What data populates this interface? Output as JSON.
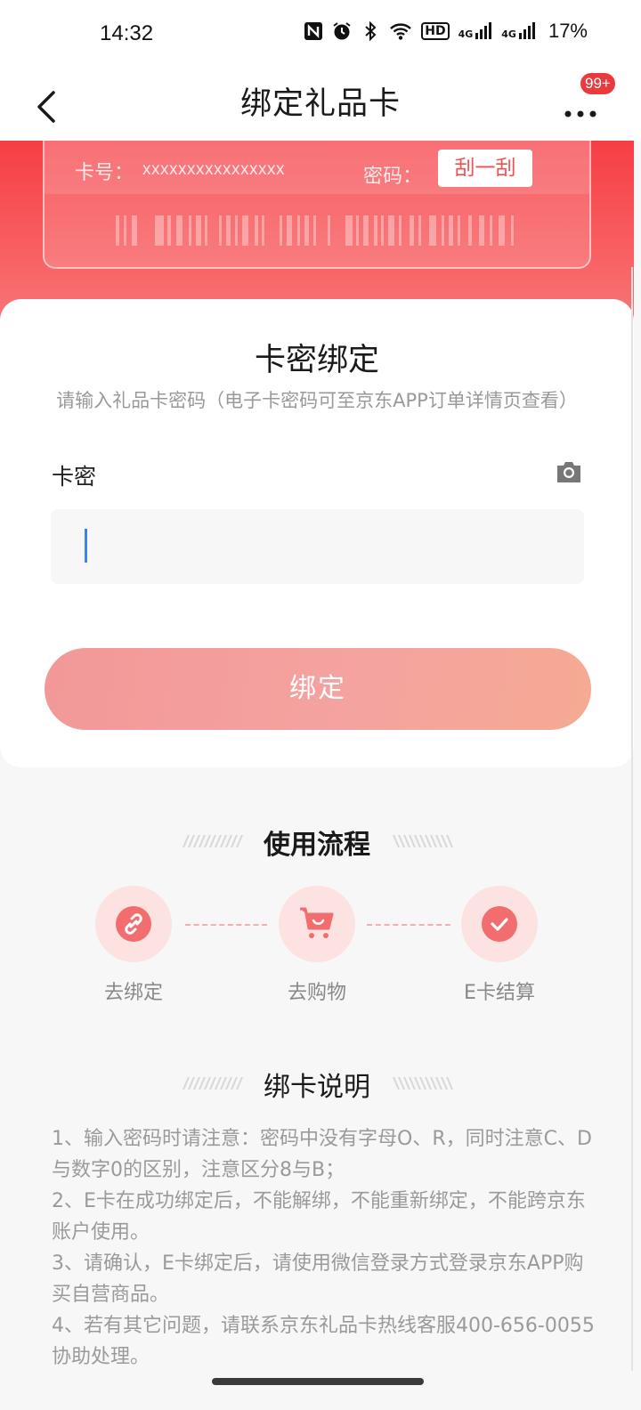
{
  "status_bar": {
    "time": "14:32",
    "icons": [
      "nfc-icon",
      "alarm-icon",
      "bluetooth-icon",
      "wifi-icon",
      "hd-icon",
      "signal-4g-icon",
      "signal-4g-icon"
    ],
    "hd_label": "HD",
    "net_label": "4G",
    "battery": "17%"
  },
  "nav": {
    "title": "绑定礼品卡",
    "badge": "99+"
  },
  "card_preview": {
    "number_label": "卡号：",
    "number_value": "xxxxxxxxxxxxxxxx",
    "password_label": "密码：",
    "scratch_label": "刮一刮"
  },
  "bind_card": {
    "title": "卡密绑定",
    "subtitle": "请输入礼品卡密码（电子卡密码可至京东APP订单详情页查看）",
    "field_label": "卡密",
    "input_value": "",
    "button_label": "绑定"
  },
  "process": {
    "title": "使用流程",
    "steps": [
      {
        "label": "去绑定",
        "icon": "link-icon"
      },
      {
        "label": "去购物",
        "icon": "cart-icon"
      },
      {
        "label": "E卡结算",
        "icon": "check-icon"
      }
    ]
  },
  "notes": {
    "title": "绑卡说明",
    "items": [
      "1、输入密码时请注意：密码中没有字母O、R，同时注意C、D与数字0的区别，注意区分8与B；",
      "2、E卡在成功绑定后，不能解绑，不能重新绑定，不能跨京东账户使用。",
      "3、请确认，E卡绑定后，请使用微信登录方式登录京东APP购买自营商品。",
      "4、若有其它问题，请联系京东礼品卡热线客服400-656-0055协助处理。"
    ]
  },
  "colors": {
    "brand_red": "#f63e44",
    "button_pink": "#f29898",
    "step_circle": "#fde2e2",
    "step_icon": "#f26d6d"
  }
}
